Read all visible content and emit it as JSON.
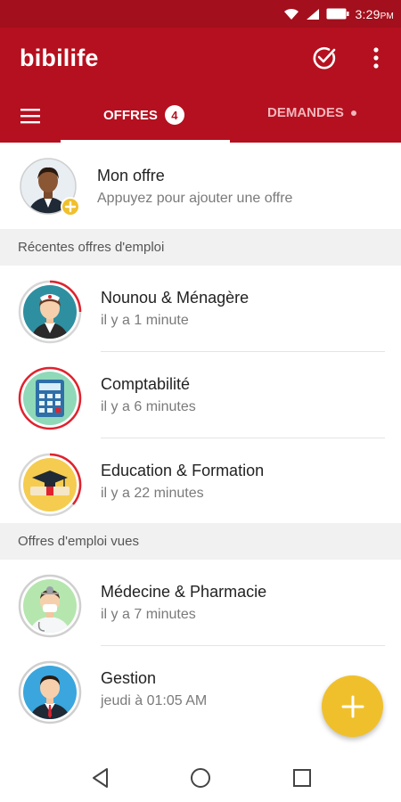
{
  "status_bar": {
    "time": "3:29",
    "ampm": "PM",
    "icons": [
      "wifi-icon",
      "signal-icon",
      "battery-icon"
    ]
  },
  "app_bar": {
    "title": "bibilife",
    "icons": [
      "check-circle-icon",
      "more-vert-icon",
      "menu-icon"
    ]
  },
  "tabs": [
    {
      "label": "OFFRES",
      "badge": "4",
      "selected": true
    },
    {
      "label": "DEMANDES",
      "dot": true,
      "selected": false
    }
  ],
  "my_offer": {
    "title": "Mon offre",
    "subtitle": "Appuyez pour ajouter une offre"
  },
  "sections": [
    {
      "header": "Récentes offres d'emploi",
      "items": [
        {
          "title": "Nounou & Ménagère",
          "time": "il y a 1 minute",
          "icon": "nanny-icon",
          "bg": "#2e8fa0",
          "ring": "#e0222e"
        },
        {
          "title": "Comptabilité",
          "time": "il y a 6 minutes",
          "icon": "calculator-icon",
          "bg": "#8fd9b8",
          "ring": "#e0222e"
        },
        {
          "title": "Education & Formation",
          "time": "il y a 22 minutes",
          "icon": "graduation-cap-icon",
          "bg": "#f5cc4f",
          "ring": "#e0222e"
        }
      ]
    },
    {
      "header": "Offres d'emploi vues",
      "items": [
        {
          "title": "Médecine & Pharmacie",
          "time": "il y a 7 minutes",
          "icon": "doctor-icon",
          "bg": "#b5e6ae",
          "ring": "#cfcfcf"
        },
        {
          "title": "Gestion",
          "time": "jeudi à 01:05 AM",
          "icon": "manager-icon",
          "bg": "#3aa6dd",
          "ring": "#cfcfcf"
        }
      ]
    }
  ],
  "fab": {
    "icon": "plus-icon",
    "color": "#f0c02c"
  },
  "nav": [
    "back-icon",
    "home-icon",
    "recents-icon"
  ],
  "colors": {
    "primary": "#b5101f",
    "status": "#a30f1c",
    "accent": "#f0c02c"
  }
}
